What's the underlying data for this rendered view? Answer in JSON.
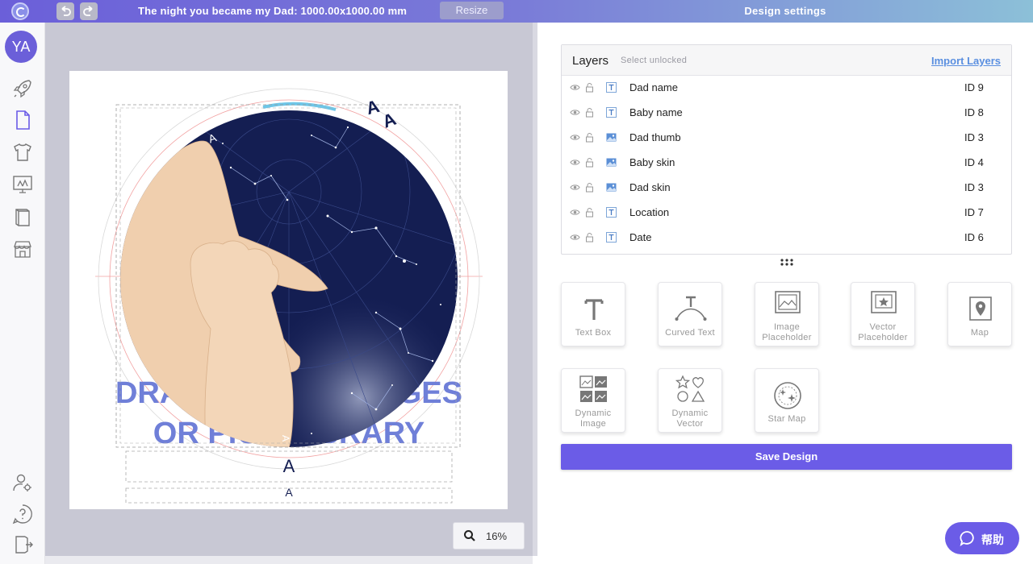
{
  "topbar": {
    "title": "The night you became my Dad: 1000.00x1000.00 mm",
    "resize_label": "Resize",
    "undo_icon": "undo-icon",
    "redo_icon": "redo-icon",
    "settings_title": "Design settings"
  },
  "sidebar": {
    "avatar_initials": "YA",
    "items": [
      {
        "icon": "rocket-icon"
      },
      {
        "icon": "document-icon"
      },
      {
        "icon": "tshirt-icon"
      },
      {
        "icon": "monitor-icon"
      },
      {
        "icon": "book-icon"
      },
      {
        "icon": "store-icon"
      },
      {
        "icon": "user-settings-icon"
      },
      {
        "icon": "help-icon"
      },
      {
        "icon": "logout-icon"
      }
    ]
  },
  "canvas": {
    "placeholder_text_line1": "DRAG & DROP IMAGES",
    "placeholder_text_line2": "OR PICK LIBRARY",
    "text_glyph": "A",
    "zoom": "16%"
  },
  "layers": {
    "title": "Layers",
    "select_unlocked": "Select unlocked",
    "import_label": "Import Layers",
    "rows": [
      {
        "name": "Dad name",
        "id": "ID 9",
        "type": "text"
      },
      {
        "name": "Baby name",
        "id": "ID 8",
        "type": "text"
      },
      {
        "name": "Dad thumb",
        "id": "ID 3",
        "type": "image"
      },
      {
        "name": "Baby skin",
        "id": "ID 4",
        "type": "image"
      },
      {
        "name": "Dad skin",
        "id": "ID 3",
        "type": "image"
      },
      {
        "name": "Location",
        "id": "ID 7",
        "type": "text"
      },
      {
        "name": "Date",
        "id": "ID 6",
        "type": "text"
      }
    ]
  },
  "tools": [
    {
      "label_1": "Text Box",
      "label_2": "",
      "icon": "text-icon"
    },
    {
      "label_1": "Curved Text",
      "label_2": "",
      "icon": "curved-text-icon"
    },
    {
      "label_1": "Image",
      "label_2": "Placeholder",
      "icon": "image-placeholder-icon"
    },
    {
      "label_1": "Vector",
      "label_2": "Placeholder",
      "icon": "vector-placeholder-icon"
    },
    {
      "label_1": "Map",
      "label_2": "",
      "icon": "map-pin-icon"
    },
    {
      "label_1": "Dynamic",
      "label_2": "Image",
      "icon": "dynamic-image-icon"
    },
    {
      "label_1": "Dynamic",
      "label_2": "Vector",
      "icon": "dynamic-vector-icon"
    },
    {
      "label_1": "Star Map",
      "label_2": "",
      "icon": "star-map-icon"
    }
  ],
  "save_label": "Save Design",
  "help_label": "帮助",
  "colors": {
    "accent": "#6b5ce7",
    "sky": "#141e52",
    "skin": "#f0cfae"
  }
}
